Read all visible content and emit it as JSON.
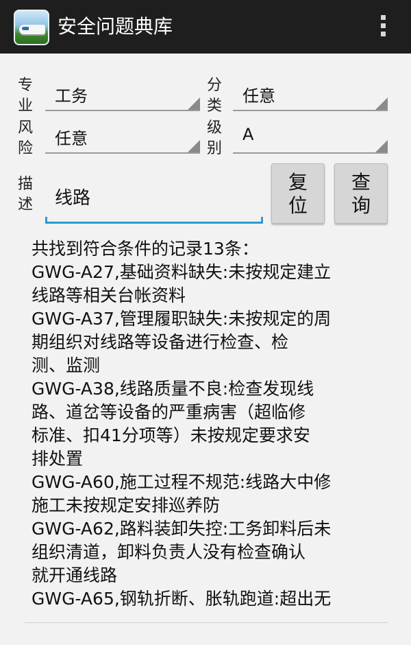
{
  "app": {
    "title": "安全问题典库",
    "icon": "train-app-icon",
    "menu_icon": "overflow-menu-icon"
  },
  "filters": {
    "specialty": {
      "label_1": "专",
      "label_2": "业",
      "value": "工务"
    },
    "category": {
      "label_1": "分",
      "label_2": "类",
      "value": "任意"
    },
    "risk": {
      "label_1": "风",
      "label_2": "险",
      "value": "任意"
    },
    "level": {
      "label_1": "级",
      "label_2": "别",
      "value": "A"
    },
    "description": {
      "label_1": "描",
      "label_2": "述",
      "value": "线路"
    }
  },
  "buttons": {
    "reset": {
      "line_1": "复",
      "line_2": "位"
    },
    "query": {
      "line_1": "查",
      "line_2": "询"
    }
  },
  "results": [
    "共找到符合条件的记录13条：",
    "GWG-A27,基础资料缺失:未按规定建立",
    "线路等相关台帐资料",
    "GWG-A37,管理履职缺失:未按规定的周",
    "期组织对线路等设备进行检查、检",
    "测、监测",
    "GWG-A38,线路质量不良:检查发现线",
    "路、道岔等设备的严重病害（超临修",
    "标准、扣41分项等）未按规定要求安",
    "排处置",
    "GWG-A60,施工过程不规范:线路大中修",
    "施工未按规定安排巡养防",
    "GWG-A62,路料装卸失控:工务卸料后未",
    "组织清道，卸料负责人没有检查确认",
    "就开通线路",
    "GWG-A65,钢轨折断、胀轨跑道:超出无"
  ],
  "colors": {
    "actionbar": "#1e1e1e",
    "background": "#f2f2f2",
    "focus_underline": "#2a9bd0",
    "button": "#d6d6d6"
  }
}
